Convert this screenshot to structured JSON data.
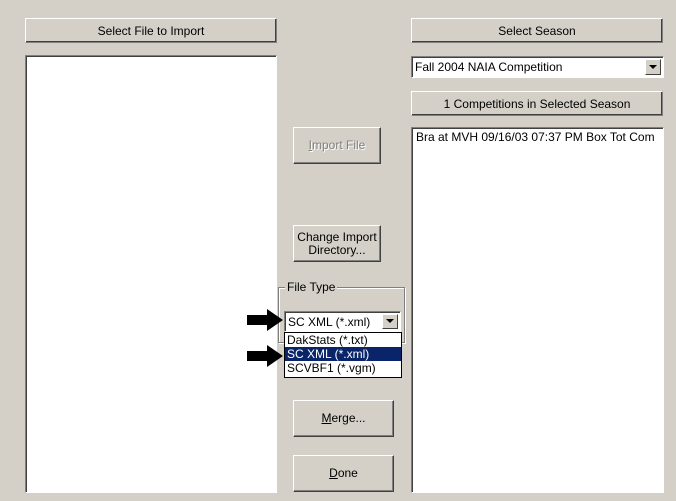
{
  "left_panel": {
    "header": "Select File to Import",
    "files": []
  },
  "right_panel": {
    "header": "Select Season",
    "season_selected": "Fall 2004 NAIA Competition",
    "competitions_header": "1 Competitions in Selected Season",
    "competitions": [
      "Bra at MVH 09/16/03 07:37 PM  Box Tot Com"
    ]
  },
  "buttons": {
    "import_file": "Import File",
    "change_dir_line1": "Change Import",
    "change_dir_line2": "Directory...",
    "merge": "Merge...",
    "done": "Done"
  },
  "file_type": {
    "label": "File Type",
    "selected": "SC XML (*.xml)",
    "options": [
      "DakStats (*.txt)",
      "SC XML (*.xml)",
      "SCVBF1 (*.vgm)"
    ]
  },
  "icons": {
    "combo_arrow": "chevron-down-icon",
    "pointer": "arrow-right-icon"
  },
  "colors": {
    "selection": "#0a246a",
    "face": "#d4d0c8"
  }
}
